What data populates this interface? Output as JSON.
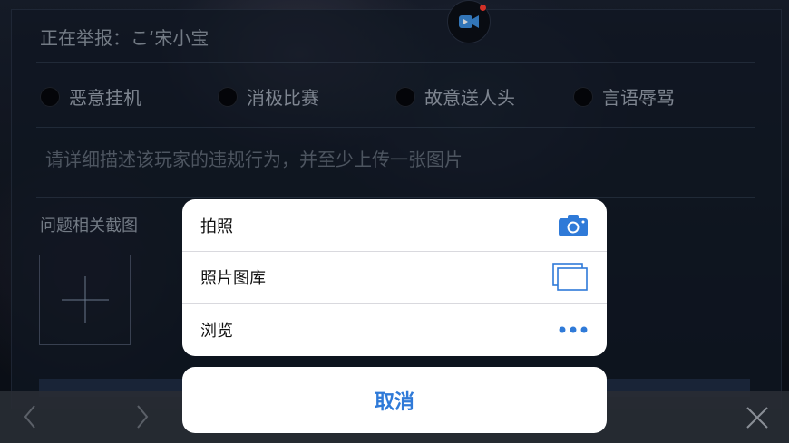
{
  "report": {
    "title": "正在举报：こ‘宋小宝",
    "reasons": [
      {
        "label": "恶意挂机"
      },
      {
        "label": "消极比赛"
      },
      {
        "label": "故意送人头"
      },
      {
        "label": "言语辱骂"
      }
    ],
    "description_placeholder": "请详细描述该玩家的违规行为，并至少上传一张图片",
    "screenshot_label": "问题相关截图"
  },
  "action_sheet": {
    "options": [
      {
        "label": "拍照",
        "icon": "camera-icon"
      },
      {
        "label": "照片图库",
        "icon": "photo-library-icon"
      },
      {
        "label": "浏览",
        "icon": "more-icon"
      }
    ],
    "cancel_label": "取消"
  },
  "colors": {
    "accent": "#2f7ad8",
    "badge_dot": "#ff3b30"
  }
}
